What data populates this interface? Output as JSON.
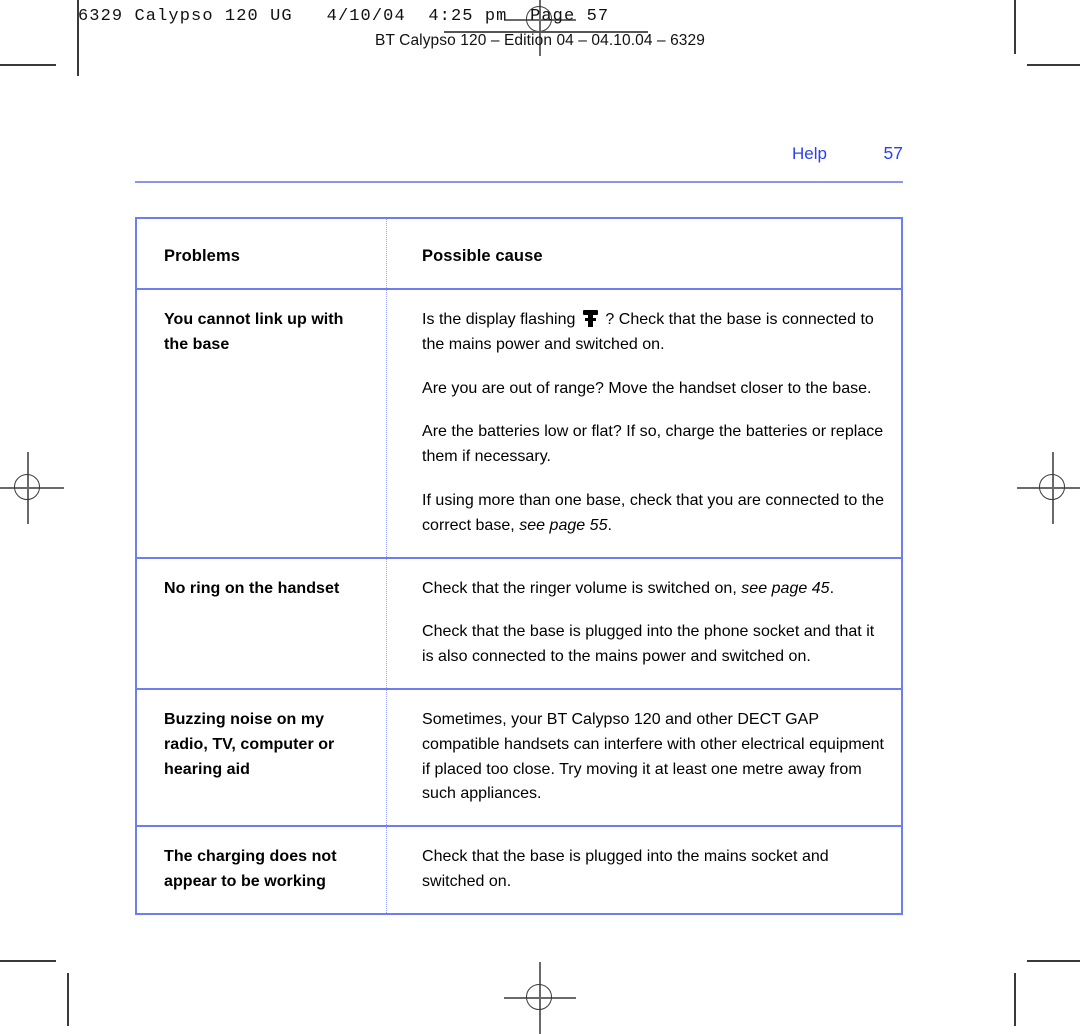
{
  "prepress": {
    "slug_line": "6329 Calypso 120 UG   4/10/04  4:25 pm  Page 57",
    "edition_line": "BT Calypso 120 – Edition 04 – 04.10.04 – 6329"
  },
  "page_header": {
    "section": "Help",
    "page_number": "57"
  },
  "table": {
    "headers": {
      "problems": "Problems",
      "possible_cause": "Possible cause"
    },
    "rows": [
      {
        "problem": "You cannot link up with the base",
        "causes": [
          {
            "before_icon": "Is the display flashing",
            "icon": "base-station-icon",
            "after_icon": "? Check that the base is connected to the mains power and switched on."
          },
          {
            "text": "Are you are out of range? Move the handset closer to the base."
          },
          {
            "text": "Are the batteries low or flat? If so, charge the batteries or replace them if necessary."
          },
          {
            "text": "If using more than one base, check that you are connected to the correct base, ",
            "italic": "see page 55",
            "tail": "."
          }
        ]
      },
      {
        "problem": "No ring on the handset",
        "causes": [
          {
            "text": "Check that the ringer volume is switched on, ",
            "italic": "see page 45",
            "tail": "."
          },
          {
            "text": "Check that the base is plugged into the phone socket and that it is also connected to the mains power and switched on."
          }
        ]
      },
      {
        "problem": "Buzzing noise on my radio, TV, computer or hearing aid",
        "causes": [
          {
            "text": "Sometimes, your BT Calypso 120 and other DECT GAP compatible handsets can interfere with other electrical equipment if placed too close. Try moving it at least one metre away from such appliances."
          }
        ]
      },
      {
        "problem": "The charging does not appear to be working",
        "causes": [
          {
            "text": "Check that the base is plugged into the mains socket and switched on."
          }
        ]
      }
    ]
  },
  "colors": {
    "rule_light": "#8b95f0",
    "table_border": "#6d7ef2",
    "header_text": "#2b3ff0",
    "column_divider": "#9aa6f5"
  }
}
